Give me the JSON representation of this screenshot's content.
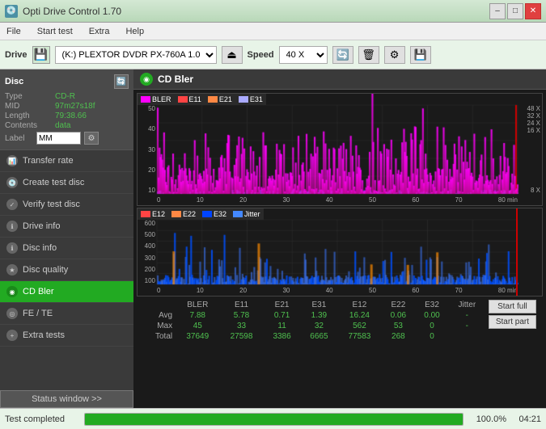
{
  "app": {
    "title": "Opti Drive Control 1.70"
  },
  "titlebar": {
    "icon": "💿",
    "title": "Opti Drive Control 1.70",
    "minimize": "–",
    "maximize": "□",
    "close": "✕"
  },
  "menubar": {
    "items": [
      {
        "label": "File"
      },
      {
        "label": "Start test"
      },
      {
        "label": "Extra"
      },
      {
        "label": "Help"
      }
    ]
  },
  "drivebar": {
    "drive_label": "Drive",
    "drive_value": "(K:)  PLEXTOR DVDR  PX-760A 1.07",
    "speed_label": "Speed",
    "speed_value": "40 X"
  },
  "disc": {
    "title": "Disc",
    "type_key": "Type",
    "type_val": "CD-R",
    "mid_key": "MID",
    "mid_val": "97m27s18f",
    "length_key": "Length",
    "length_val": "79:38.66",
    "contents_key": "Contents",
    "contents_val": "data",
    "label_key": "Label",
    "label_val": "MM"
  },
  "sidebar": {
    "nav_items": [
      {
        "label": "Transfer rate",
        "active": false
      },
      {
        "label": "Create test disc",
        "active": false
      },
      {
        "label": "Verify test disc",
        "active": false
      },
      {
        "label": "Drive info",
        "active": false
      },
      {
        "label": "Disc info",
        "active": false
      },
      {
        "label": "Disc quality",
        "active": false
      },
      {
        "label": "CD Bler",
        "active": true
      },
      {
        "label": "FE / TE",
        "active": false
      },
      {
        "label": "Extra tests",
        "active": false
      }
    ],
    "status_window": "Status window >>"
  },
  "chart": {
    "title": "CD Bler",
    "top_legend": [
      {
        "color": "#ff00ff",
        "label": "BLER"
      },
      {
        "color": "#ff4444",
        "label": "E11"
      },
      {
        "color": "#ff8844",
        "label": "E21"
      },
      {
        "color": "#aaaaff",
        "label": "E31"
      }
    ],
    "bottom_legend": [
      {
        "color": "#ff4444",
        "label": "E12"
      },
      {
        "color": "#ff8844",
        "label": "E22"
      },
      {
        "color": "#0000ff",
        "label": "E32"
      },
      {
        "color": "#4488ff",
        "label": "Jitter"
      }
    ],
    "top_y_labels": [
      "48 X",
      "32 X",
      "24 X",
      "16 X",
      "8 X"
    ],
    "bottom_y_labels": [
      "600",
      "500",
      "400",
      "300",
      "200",
      "100"
    ],
    "x_labels": [
      "0",
      "10",
      "20",
      "30",
      "40",
      "50",
      "60",
      "70",
      "80 min"
    ]
  },
  "stats": {
    "headers": [
      "",
      "BLER",
      "E11",
      "E21",
      "E31",
      "E12",
      "E22",
      "E32",
      "Jitter"
    ],
    "rows": [
      {
        "label": "Avg",
        "values": [
          "7.88",
          "5.78",
          "0.71",
          "1.39",
          "16.24",
          "0.06",
          "0.00",
          "-"
        ]
      },
      {
        "label": "Max",
        "values": [
          "45",
          "33",
          "11",
          "32",
          "562",
          "53",
          "0",
          "-"
        ]
      },
      {
        "label": "Total",
        "values": [
          "37649",
          "27598",
          "3386",
          "6665",
          "77583",
          "268",
          "0",
          ""
        ]
      }
    ],
    "start_full": "Start full",
    "start_part": "Start part"
  },
  "statusbar": {
    "status_text": "Test completed",
    "progress_pct": 100,
    "progress_label": "100.0%",
    "time": "04:21"
  }
}
